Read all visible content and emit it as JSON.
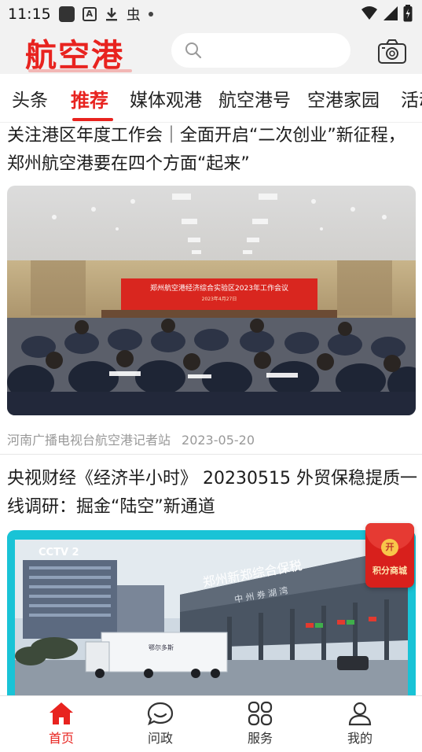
{
  "status_bar": {
    "time": "11:15",
    "notif_a_label": "A",
    "bug_glyph": "虫"
  },
  "header": {
    "logo_text": "航空港",
    "search_placeholder": "",
    "icons": [
      "search-icon",
      "camera-icon"
    ]
  },
  "tabs": [
    {
      "label": "头条"
    },
    {
      "label": "推荐",
      "active": true
    },
    {
      "label": "媒体观港"
    },
    {
      "label": "航空港号"
    },
    {
      "label": "空港家园"
    },
    {
      "label": "活动"
    }
  ],
  "articles": [
    {
      "title": "关注港区年度工作会｜全面开启“二次创业”新征程，郑州航空港要在四个方面“起来”",
      "image_banner_text": "郑州航空港经济综合实验区2023年工作会议",
      "image_banner_sub": "2023年4月27日",
      "source": "河南广播电视台航空港记者站",
      "date": "2023-05-20"
    },
    {
      "title": "央视财经《经济半小时》 20230515 外贸保稳提质一线调研：掘金“陆空”新通道",
      "image_gate_text": "郑州新郑综合保税",
      "image_gate_sub": "中 州 券 湖 湾",
      "image_channel_logo": "CCTV 2",
      "image_truck_text": "鄂尔多斯"
    }
  ],
  "floating": {
    "coin_text": "开",
    "label": "积分商城"
  },
  "bottom_nav": [
    {
      "label": "首页",
      "icon": "home-icon",
      "active": true
    },
    {
      "label": "问政",
      "icon": "chat-icon"
    },
    {
      "label": "服务",
      "icon": "grid-icon"
    },
    {
      "label": "我的",
      "icon": "user-icon"
    }
  ],
  "colors": {
    "accent": "#e8231f",
    "header_bg": "#f2f2f2"
  }
}
